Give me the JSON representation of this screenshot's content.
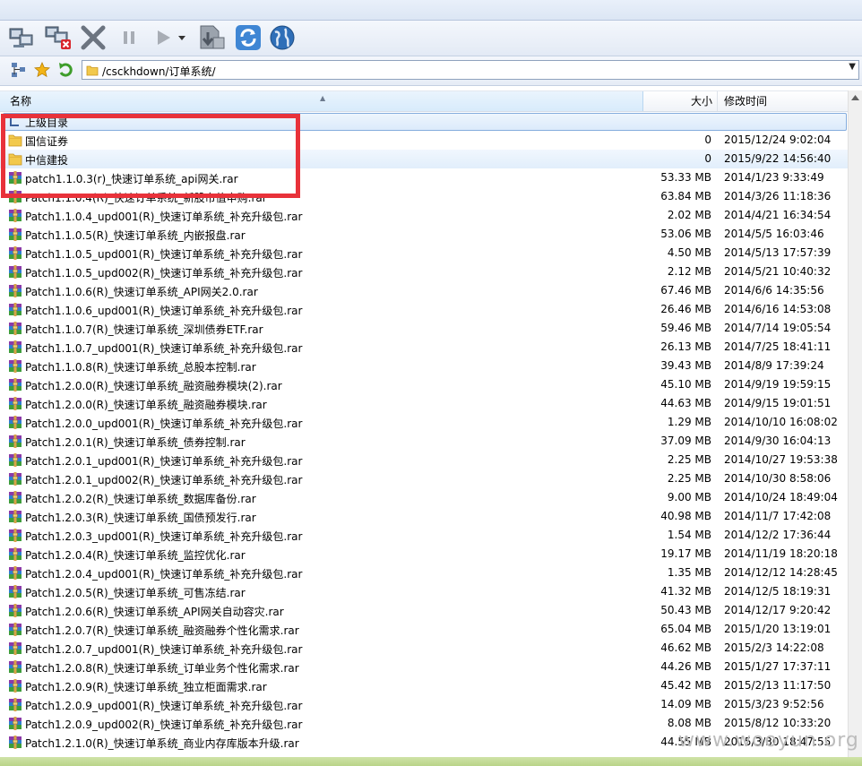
{
  "address": {
    "path": "/csckhdown/订单系统/"
  },
  "columns": {
    "name": "名称",
    "size": "大小",
    "mtime": "修改时间"
  },
  "files": [
    {
      "name": "上级目录",
      "size": "",
      "mtime": "",
      "kind": "up"
    },
    {
      "name": "国信证券",
      "size": "0",
      "mtime": "2015/12/24 9:02:04",
      "kind": "folder"
    },
    {
      "name": "中信建投",
      "size": "0",
      "mtime": "2015/9/22 14:56:40",
      "kind": "folder",
      "selected": true
    },
    {
      "name": "patch1.1.0.3(r)_快速订单系统_api网关.rar",
      "size": "53.33 MB",
      "mtime": "2014/1/23 9:33:49",
      "kind": "rar"
    },
    {
      "name": "Patch1.1.0.4(R)_快速订单系统_新股市值申购.rar",
      "size": "63.84 MB",
      "mtime": "2014/3/26 11:18:36",
      "kind": "rar"
    },
    {
      "name": "Patch1.1.0.4_upd001(R)_快速订单系统_补充升级包.rar",
      "size": "2.02 MB",
      "mtime": "2014/4/21 16:34:54",
      "kind": "rar"
    },
    {
      "name": "Patch1.1.0.5(R)_快速订单系统_内嵌报盘.rar",
      "size": "53.06 MB",
      "mtime": "2014/5/5 16:03:46",
      "kind": "rar"
    },
    {
      "name": "Patch1.1.0.5_upd001(R)_快速订单系统_补充升级包.rar",
      "size": "4.50 MB",
      "mtime": "2014/5/13 17:57:39",
      "kind": "rar"
    },
    {
      "name": "Patch1.1.0.5_upd002(R)_快速订单系统_补充升级包.rar",
      "size": "2.12 MB",
      "mtime": "2014/5/21 10:40:32",
      "kind": "rar"
    },
    {
      "name": "Patch1.1.0.6(R)_快速订单系统_API网关2.0.rar",
      "size": "67.46 MB",
      "mtime": "2014/6/6 14:35:56",
      "kind": "rar"
    },
    {
      "name": "Patch1.1.0.6_upd001(R)_快速订单系统_补充升级包.rar",
      "size": "26.46 MB",
      "mtime": "2014/6/16 14:53:08",
      "kind": "rar"
    },
    {
      "name": "Patch1.1.0.7(R)_快速订单系统_深圳债券ETF.rar",
      "size": "59.46 MB",
      "mtime": "2014/7/14 19:05:54",
      "kind": "rar"
    },
    {
      "name": "Patch1.1.0.7_upd001(R)_快速订单系统_补充升级包.rar",
      "size": "26.13 MB",
      "mtime": "2014/7/25 18:41:11",
      "kind": "rar"
    },
    {
      "name": "Patch1.1.0.8(R)_快速订单系统_总股本控制.rar",
      "size": "39.43 MB",
      "mtime": "2014/8/9 17:39:24",
      "kind": "rar"
    },
    {
      "name": "Patch1.2.0.0(R)_快速订单系统_融资融券模块(2).rar",
      "size": "45.10 MB",
      "mtime": "2014/9/19 19:59:15",
      "kind": "rar"
    },
    {
      "name": "Patch1.2.0.0(R)_快速订单系统_融资融券模块.rar",
      "size": "44.63 MB",
      "mtime": "2014/9/15 19:01:51",
      "kind": "rar"
    },
    {
      "name": "Patch1.2.0.0_upd001(R)_快速订单系统_补充升级包.rar",
      "size": "1.29 MB",
      "mtime": "2014/10/10 16:08:02",
      "kind": "rar"
    },
    {
      "name": "Patch1.2.0.1(R)_快速订单系统_债券控制.rar",
      "size": "37.09 MB",
      "mtime": "2014/9/30 16:04:13",
      "kind": "rar"
    },
    {
      "name": "Patch1.2.0.1_upd001(R)_快速订单系统_补充升级包.rar",
      "size": "2.25 MB",
      "mtime": "2014/10/27 19:53:38",
      "kind": "rar"
    },
    {
      "name": "Patch1.2.0.1_upd002(R)_快速订单系统_补充升级包.rar",
      "size": "2.25 MB",
      "mtime": "2014/10/30 8:58:06",
      "kind": "rar"
    },
    {
      "name": "Patch1.2.0.2(R)_快速订单系统_数据库备份.rar",
      "size": "9.00 MB",
      "mtime": "2014/10/24 18:49:04",
      "kind": "rar"
    },
    {
      "name": "Patch1.2.0.3(R)_快速订单系统_国债预发行.rar",
      "size": "40.98 MB",
      "mtime": "2014/11/7 17:42:08",
      "kind": "rar"
    },
    {
      "name": "Patch1.2.0.3_upd001(R)_快速订单系统_补充升级包.rar",
      "size": "1.54 MB",
      "mtime": "2014/12/2 17:36:44",
      "kind": "rar"
    },
    {
      "name": "Patch1.2.0.4(R)_快速订单系统_监控优化.rar",
      "size": "19.17 MB",
      "mtime": "2014/11/19 18:20:18",
      "kind": "rar"
    },
    {
      "name": "Patch1.2.0.4_upd001(R)_快速订单系统_补充升级包.rar",
      "size": "1.35 MB",
      "mtime": "2014/12/12 14:28:45",
      "kind": "rar"
    },
    {
      "name": "Patch1.2.0.5(R)_快速订单系统_可售冻结.rar",
      "size": "41.32 MB",
      "mtime": "2014/12/5 18:19:31",
      "kind": "rar"
    },
    {
      "name": "Patch1.2.0.6(R)_快速订单系统_API网关自动容灾.rar",
      "size": "50.43 MB",
      "mtime": "2014/12/17 9:20:42",
      "kind": "rar"
    },
    {
      "name": "Patch1.2.0.7(R)_快速订单系统_融资融券个性化需求.rar",
      "size": "65.04 MB",
      "mtime": "2015/1/20 13:19:01",
      "kind": "rar"
    },
    {
      "name": "Patch1.2.0.7_upd001(R)_快速订单系统_补充升级包.rar",
      "size": "46.62 MB",
      "mtime": "2015/2/3 14:22:08",
      "kind": "rar"
    },
    {
      "name": "Patch1.2.0.8(R)_快速订单系统_订单业务个性化需求.rar",
      "size": "44.26 MB",
      "mtime": "2015/1/27 17:37:11",
      "kind": "rar"
    },
    {
      "name": "Patch1.2.0.9(R)_快速订单系统_独立柜面需求.rar",
      "size": "45.42 MB",
      "mtime": "2015/2/13 11:17:50",
      "kind": "rar"
    },
    {
      "name": "Patch1.2.0.9_upd001(R)_快速订单系统_补充升级包.rar",
      "size": "14.09 MB",
      "mtime": "2015/3/23 9:52:56",
      "kind": "rar"
    },
    {
      "name": "Patch1.2.0.9_upd002(R)_快速订单系统_补充升级包.rar",
      "size": "8.08 MB",
      "mtime": "2015/8/12 10:33:20",
      "kind": "rar"
    },
    {
      "name": "Patch1.2.1.0(R)_快速订单系统_商业内存库版本升级.rar",
      "size": "44.55 MB",
      "mtime": "2015/3/30 18:47:55",
      "kind": "rar"
    }
  ],
  "watermark": "www.wooyun.org",
  "colors": {
    "annotation": "#e8323a",
    "selection": "#e1eefb"
  }
}
